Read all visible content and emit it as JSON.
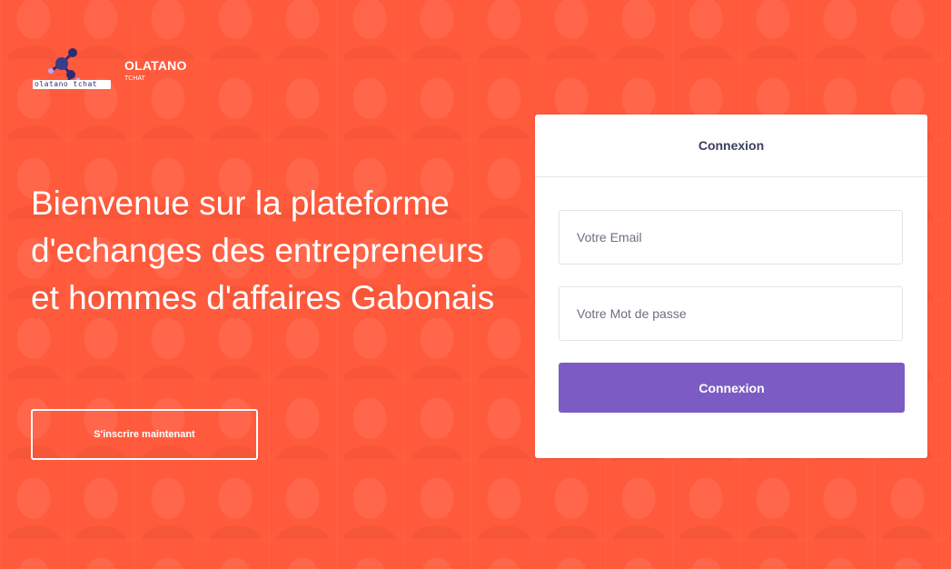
{
  "brand": {
    "name": "OLATANO",
    "subtitle": "TCHAT",
    "logo_icon": "molecule-logo-icon",
    "logo_wordmark": "olatano tchat"
  },
  "hero": {
    "title": "Bienvenue sur la plateforme d'echanges des entrepreneurs et hommes d'affaires Gabonais",
    "signup_label": "S'inscrire maintenant"
  },
  "login": {
    "header": "Connexion",
    "email_placeholder": "Votre Email",
    "password_placeholder": "Votre Mot de passe",
    "submit_label": "Connexion"
  },
  "colors": {
    "background": "#ff5a3c",
    "accent": "#7c5cc4",
    "card": "#ffffff",
    "header_text": "#3b3f5c"
  }
}
